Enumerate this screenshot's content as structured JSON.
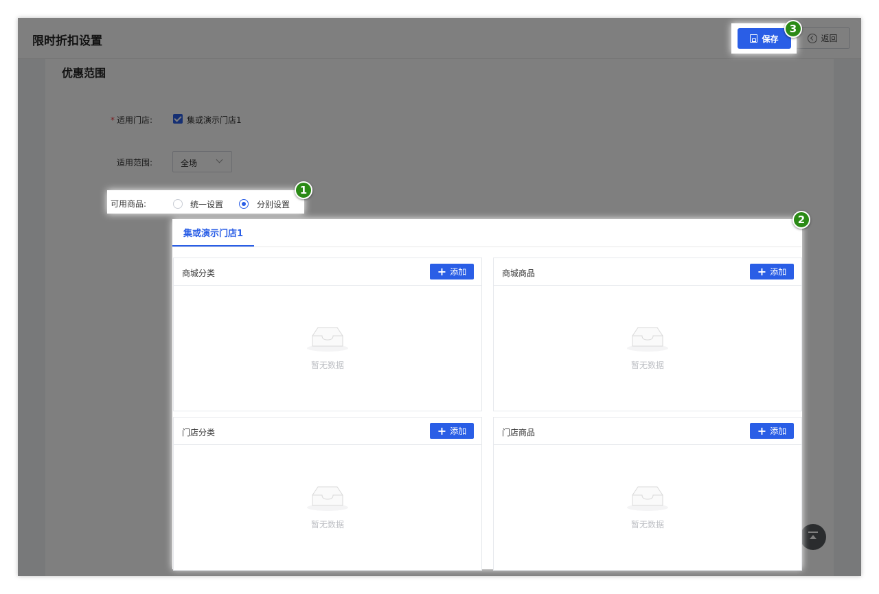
{
  "header": {
    "title": "限时折扣设置",
    "save_label": "保存",
    "back_label": "返回"
  },
  "section": {
    "title": "优惠范围"
  },
  "form": {
    "store_label": "适用门店:",
    "store_required": "*",
    "store_value": "集或演示门店1",
    "range_label": "适用范围:",
    "range_value": "全场",
    "goods_label": "可用商品:",
    "goods_options": [
      "统一设置",
      "分别设置"
    ],
    "goods_selected": "分别设置"
  },
  "tabs": [
    {
      "label": "集或演示门店1",
      "active": true
    }
  ],
  "panels": [
    {
      "title": "商城分类",
      "add_label": "添加",
      "empty_text": "暂无数据"
    },
    {
      "title": "商城商品",
      "add_label": "添加",
      "empty_text": "暂无数据"
    },
    {
      "title": "门店分类",
      "add_label": "添加",
      "empty_text": "暂无数据"
    },
    {
      "title": "门店商品",
      "add_label": "添加",
      "empty_text": "暂无数据"
    }
  ],
  "markers": [
    "1",
    "2",
    "3"
  ],
  "colors": {
    "primary": "#2a5ee6",
    "marker": "#2b8a16",
    "required": "#f2353c"
  }
}
